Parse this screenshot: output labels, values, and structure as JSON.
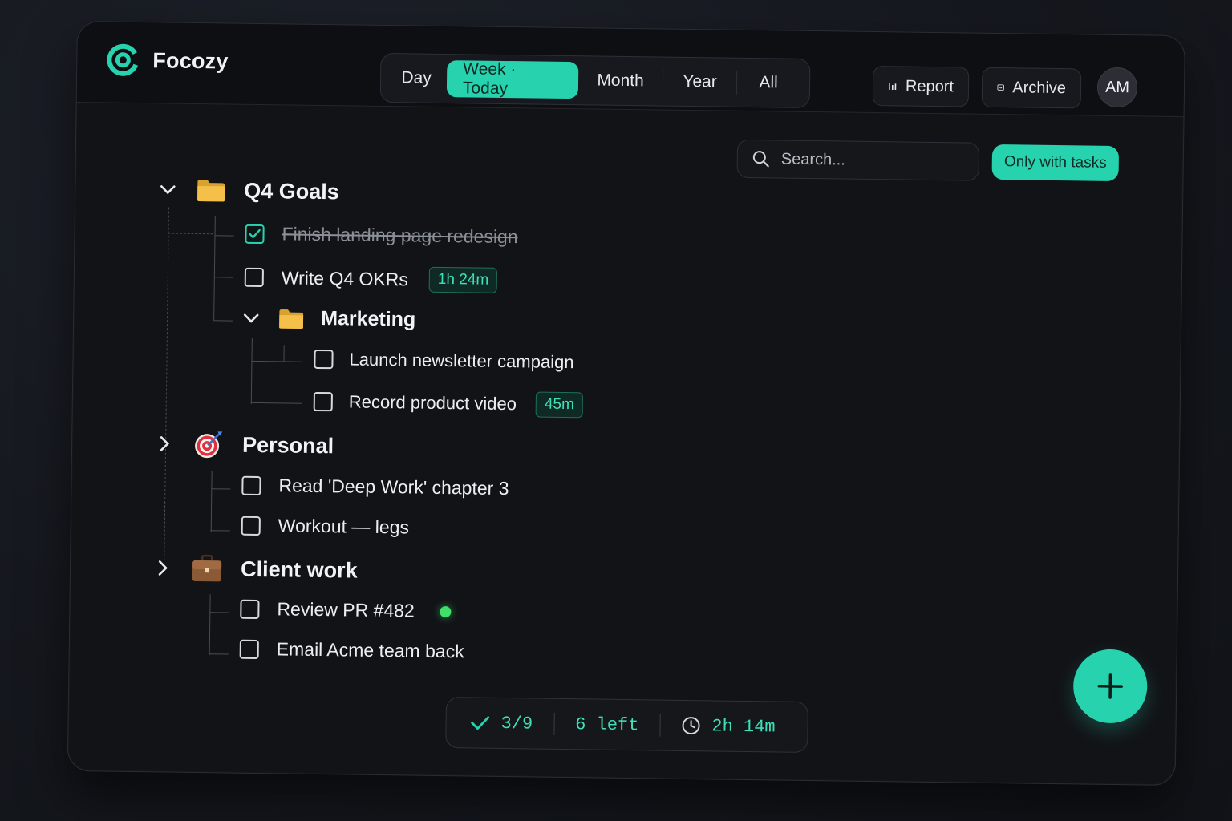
{
  "app": {
    "name": "Focozy"
  },
  "ranges": {
    "day": "Day",
    "week": "Week · Today",
    "month": "Month",
    "year": "Year",
    "all": "All"
  },
  "toolbar": {
    "report": "Report",
    "archive": "Archive",
    "avatar_initials": "AM"
  },
  "search": {
    "placeholder": "Search..."
  },
  "filter": {
    "label": "Only with tasks"
  },
  "groups": [
    {
      "title": "Q4 Goals",
      "icon": "folder-icon",
      "expanded": true,
      "tasks": [
        {
          "label": "Finish landing page redesign",
          "done": true
        },
        {
          "label": "Write Q4 OKRs",
          "done": false,
          "duration": "1h 24m"
        }
      ],
      "subgroups": [
        {
          "title": "Marketing",
          "icon": "folder-icon",
          "expanded": true,
          "tasks": [
            {
              "label": "Launch newsletter campaign",
              "done": false
            },
            {
              "label": "Record product video",
              "done": false,
              "duration": "45m"
            }
          ]
        }
      ]
    },
    {
      "title": "Personal",
      "icon": "target-icon",
      "expanded": false,
      "tasks": [
        {
          "label": "Read 'Deep Work' chapter 3",
          "done": false
        },
        {
          "label": "Workout — legs",
          "done": false
        }
      ]
    },
    {
      "title": "Client work",
      "icon": "briefcase-icon",
      "expanded": false,
      "tasks": [
        {
          "label": "Review PR #482",
          "done": false,
          "status": "active"
        },
        {
          "label": "Email Acme team back",
          "done": false
        }
      ]
    }
  ],
  "status": {
    "done": "3/9",
    "left": "6 left",
    "time": "2h 14m"
  },
  "colors": {
    "accent": "#27d3ae",
    "background": "#121317",
    "active_dot": "#3ee06a",
    "folder": "#f5c04a"
  }
}
